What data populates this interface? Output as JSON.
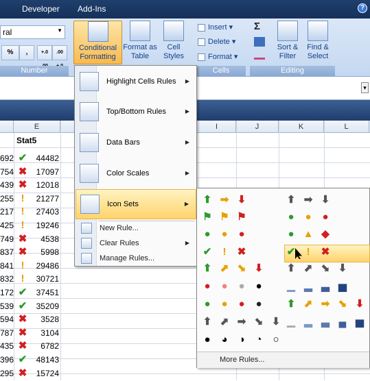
{
  "tabs": [
    "Developer",
    "Add-Ins"
  ],
  "ribbon": {
    "number_format": "ral",
    "number_buttons": [
      "%",
      ",",
      "+.0 .00",
      ".00 +.0"
    ],
    "number_group": "Number",
    "conditional_formatting": "Conditional Formatting",
    "format_as_table": "Format as Table",
    "cell_styles": "Cell Styles",
    "cells_buttons": [
      "Insert",
      "Delete",
      "Format"
    ],
    "cells_group": "Cells",
    "sort_filter": "Sort & Filter",
    "find_select": "Find & Select",
    "editing_group": "Editing",
    "sigma": "Σ"
  },
  "columns": [
    "E",
    "I",
    "J",
    "K",
    "L"
  ],
  "column_header_label": "Stat5",
  "rows": [
    {
      "d": "692",
      "icon": "check",
      "v": "44482"
    },
    {
      "d": "754",
      "icon": "cross",
      "v": "17097"
    },
    {
      "d": "439",
      "icon": "cross",
      "v": "12018"
    },
    {
      "d": "255",
      "icon": "excl",
      "v": "21277"
    },
    {
      "d": "217",
      "icon": "excl",
      "v": "27403"
    },
    {
      "d": "425",
      "icon": "excl",
      "v": "19246"
    },
    {
      "d": "749",
      "icon": "cross",
      "v": "4538"
    },
    {
      "d": "837",
      "icon": "cross",
      "v": "5998"
    },
    {
      "d": "841",
      "icon": "excl",
      "v": "29486"
    },
    {
      "d": "832",
      "icon": "excl",
      "v": "30721"
    },
    {
      "d": "172",
      "icon": "check",
      "v": "37451"
    },
    {
      "d": "539",
      "icon": "check",
      "v": "35209"
    },
    {
      "d": "594",
      "icon": "cross",
      "v": "3528"
    },
    {
      "d": "787",
      "icon": "cross",
      "v": "3104"
    },
    {
      "d": "435",
      "icon": "cross",
      "v": "6782"
    },
    {
      "d": "396",
      "icon": "check",
      "v": "48143"
    },
    {
      "d": "295",
      "icon": "cross",
      "v": "15724"
    }
  ],
  "menu": {
    "items": [
      "Highlight Cells Rules",
      "Top/Bottom Rules",
      "Data Bars",
      "Color Scales",
      "Icon Sets"
    ],
    "small_items": [
      "New Rule...",
      "Clear Rules",
      "Manage Rules..."
    ]
  },
  "submenu": {
    "more_rules": "More Rules..."
  },
  "colors": {
    "green": "#2e9a2e",
    "red": "#d21f1f",
    "amber": "#e6a100",
    "accent": "#ffd36b"
  }
}
